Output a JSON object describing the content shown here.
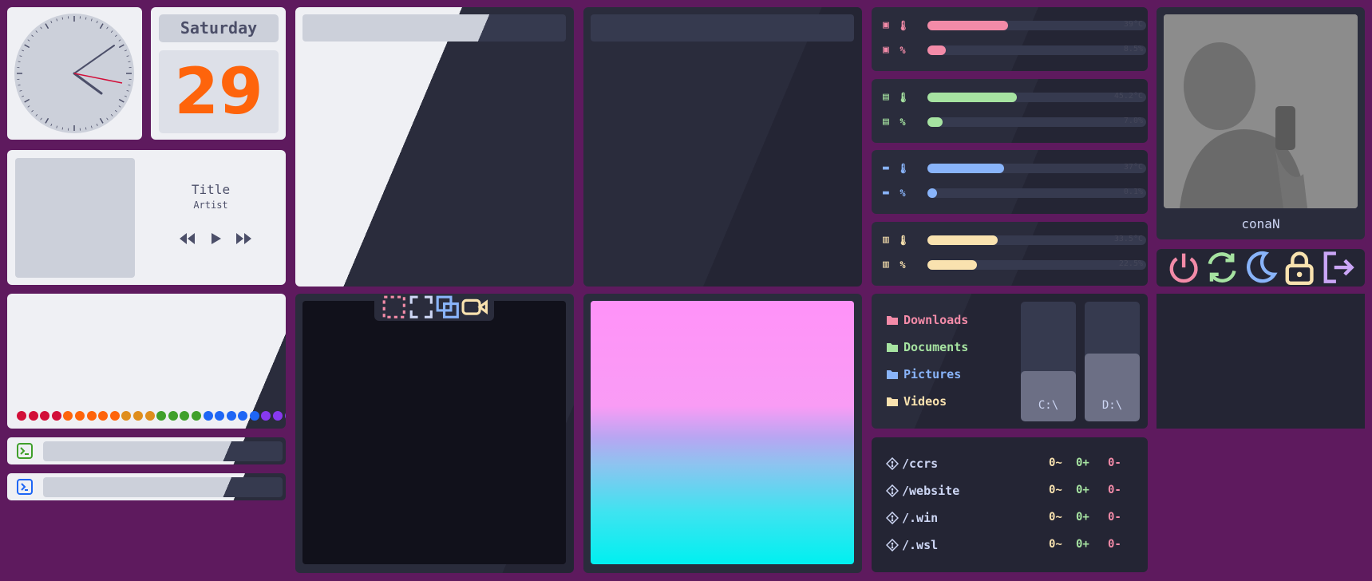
{
  "date": {
    "weekday": "Saturday",
    "day": "29"
  },
  "music": {
    "title": "Title",
    "artist": "Artist"
  },
  "palette": [
    "#d20f39",
    "#d20f39",
    "#d20f39",
    "#d20f39",
    "#fe640b",
    "#fe640b",
    "#fe640b",
    "#fe640b",
    "#fe640b",
    "#df8e1d",
    "#df8e1d",
    "#df8e1d",
    "#40a02b",
    "#40a02b",
    "#40a02b",
    "#40a02b",
    "#1e66f5",
    "#1e66f5",
    "#1e66f5",
    "#1e66f5",
    "#1e66f5",
    "#8839ef",
    "#8839ef",
    "#8839ef",
    "#dd7ef4"
  ],
  "stats": [
    {
      "name": "cpu",
      "color": "#f38ba8",
      "rows": [
        {
          "kind": "temp",
          "value": "39°C",
          "fraction": 0.37
        },
        {
          "kind": "percent",
          "value": "8.5%",
          "fraction": 0.085
        }
      ]
    },
    {
      "name": "gpu",
      "color": "#a6e3a1",
      "rows": [
        {
          "kind": "temp",
          "value": "45.2°C",
          "fraction": 0.41
        },
        {
          "kind": "percent",
          "value": "7.0%",
          "fraction": 0.07
        }
      ]
    },
    {
      "name": "disk",
      "color": "#89b4fa",
      "rows": [
        {
          "kind": "temp",
          "value": "37°C",
          "fraction": 0.35
        },
        {
          "kind": "percent",
          "value": "0.1%",
          "fraction": 0.03
        }
      ]
    },
    {
      "name": "ram",
      "color": "#f9e2af",
      "rows": [
        {
          "kind": "temp",
          "value": "33.5°C",
          "fraction": 0.32
        },
        {
          "kind": "percent",
          "value": "22.5%",
          "fraction": 0.225
        }
      ]
    }
  ],
  "user": {
    "name": "conaN"
  },
  "power": [
    {
      "icon": "power-icon",
      "color": "#f38ba8"
    },
    {
      "icon": "restart-icon",
      "color": "#a6e3a1"
    },
    {
      "icon": "sleep-icon",
      "color": "#89b4fa"
    },
    {
      "icon": "lock-icon",
      "color": "#f9e2af"
    },
    {
      "icon": "logout-icon",
      "color": "#cba6f7"
    }
  ],
  "folders": [
    {
      "label": "Downloads",
      "color": "#f38ba8"
    },
    {
      "label": "Documents",
      "color": "#a6e3a1"
    },
    {
      "label": "Pictures",
      "color": "#89b4fa"
    },
    {
      "label": "Videos",
      "color": "#f9e2af"
    }
  ],
  "drives": [
    {
      "label": "C:\\",
      "used_fraction": 0.42
    },
    {
      "label": "D:\\",
      "used_fraction": 0.57
    }
  ],
  "repos": [
    {
      "name": "/ccrs",
      "changed": "0~",
      "added": "0+",
      "removed": "0-"
    },
    {
      "name": "/website",
      "changed": "0~",
      "added": "0+",
      "removed": "0-"
    },
    {
      "name": "/.win",
      "changed": "0~",
      "added": "0+",
      "removed": "0-"
    },
    {
      "name": "/.wsl",
      "changed": "0~",
      "added": "0+",
      "removed": "0-"
    }
  ],
  "colors": {
    "accent": "#fe640b",
    "border": "#5e1a5e",
    "light": "#eff0f4",
    "dark": "#2a2c3c"
  }
}
